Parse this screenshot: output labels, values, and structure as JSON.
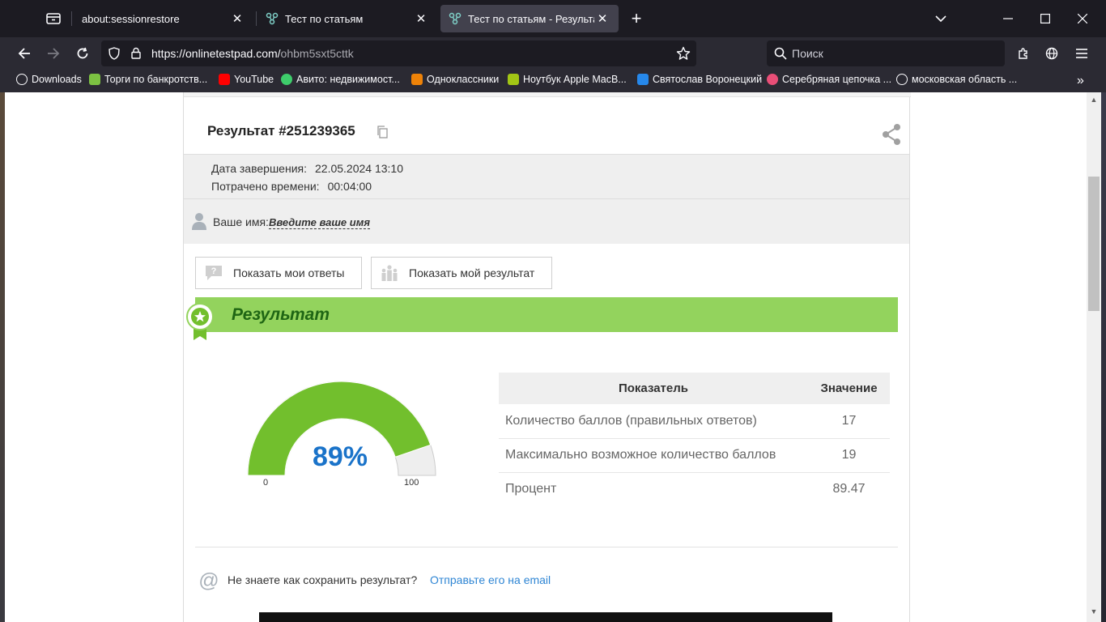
{
  "browser": {
    "tabs": [
      {
        "title": "about:sessionrestore",
        "active": false
      },
      {
        "title": "Тест по статьям",
        "active": false
      },
      {
        "title": "Тест по статьям - Результат он",
        "active": true
      }
    ],
    "url": {
      "host": "https://onlinetestpad.com/",
      "path": "ohbm5sxt5cttk"
    },
    "search_placeholder": "Поиск",
    "bookmarks": [
      {
        "label": "Downloads",
        "color": "#fbfbfe"
      },
      {
        "label": "Торги по банкротств...",
        "color": "#7cc142"
      },
      {
        "label": "YouTube",
        "color": "#ff0000"
      },
      {
        "label": "Авито: недвижимост...",
        "color": "#3ecd6b"
      },
      {
        "label": "Одноклассники",
        "color": "#ee8208"
      },
      {
        "label": "Ноутбук Apple MacB...",
        "color": "#a2c615"
      },
      {
        "label": "Святослав Воронецкий",
        "color": "#2688eb"
      },
      {
        "label": "Серебряная цепочка ...",
        "color": "#e94e77"
      },
      {
        "label": "московская область ...",
        "color": "#fbfbfe"
      }
    ]
  },
  "result": {
    "title": "Результат #251239365",
    "finished_label": "Дата завершения:",
    "finished_value": "22.05.2024 13:10",
    "spent_label": "Потрачено времени:",
    "spent_value": "00:04:00",
    "name_label": "Ваше имя:",
    "name_link": "Введите ваше имя",
    "show_answers": "Показать мои ответы",
    "show_result": "Показать мой результат",
    "banner": "Результат"
  },
  "gauge": {
    "percent_text": "89%",
    "value": 89.47,
    "min_label": "0",
    "max_label": "100",
    "color": "#72bf2d"
  },
  "table": {
    "headers": [
      "Показатель",
      "Значение"
    ],
    "rows": [
      [
        "Количество баллов (правильных ответов)",
        "17"
      ],
      [
        "Максимально возможное количество баллов",
        "19"
      ],
      [
        "Процент",
        "89.47"
      ]
    ]
  },
  "footer": {
    "question": "Не знаете как сохранить результат?",
    "link": "Отправьте его на email"
  }
}
